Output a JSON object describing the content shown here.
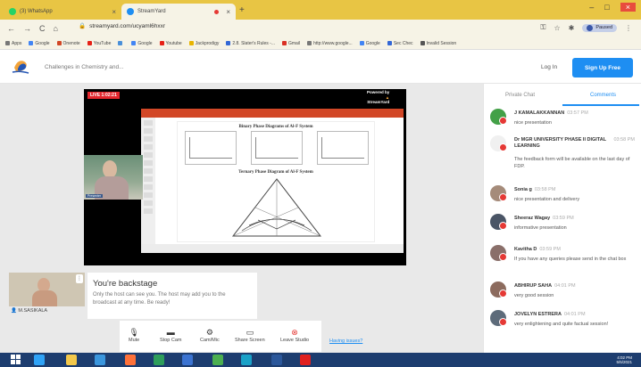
{
  "browser": {
    "tabs": [
      {
        "label": "(3) WhatsApp",
        "icon": "whatsapp-icon",
        "color": "#25d366"
      },
      {
        "label": "StreamYard",
        "icon": "streamyard-icon",
        "color": "#1e8ef2",
        "recording": true
      }
    ],
    "url": "streamyard.com/ucyaml6hxxr",
    "profile_label": "Paused",
    "profile_initial": "G",
    "bookmarks": [
      {
        "label": "Apps",
        "color": "#777"
      },
      {
        "label": "Google",
        "color": "#4285f4"
      },
      {
        "label": "Onenote",
        "color": "#d24726"
      },
      {
        "label": "YouTube",
        "color": "#e62117"
      },
      {
        "label": "",
        "color": "#4a90d9"
      },
      {
        "label": "Google",
        "color": "#4285f4"
      },
      {
        "label": "Youtube",
        "color": "#e62117"
      },
      {
        "label": "Jackprodigy",
        "color": "#e8b400"
      },
      {
        "label": "2.8. Slater's Rules -...",
        "color": "#3367d6"
      },
      {
        "label": "Gmail",
        "color": "#d93025"
      },
      {
        "label": "http://www.google...",
        "color": "#777"
      },
      {
        "label": "Google",
        "color": "#4285f4"
      },
      {
        "label": "Sec Chec",
        "color": "#3367d6"
      },
      {
        "label": "Invalid Session",
        "color": "#555"
      }
    ]
  },
  "header": {
    "show_title": "Challenges in Chemistry and...",
    "login": "Log In",
    "signup": "Sign Up Free"
  },
  "stage": {
    "live_label": "LIVE 1:02:21",
    "powered_by": "Powered by",
    "brand": "StreamYard",
    "slide_title_1": "Binary Phase Diagrams of Al-F System",
    "slide_title_2": "Ternary Phase Diagram of Al-F System",
    "presenter_tag": "Presenter"
  },
  "backstage": {
    "participant_name": "M.SASIKALA",
    "title": "You're backstage",
    "description": "Only the host can see you. The host may add you to the broadcast at any time. Be ready!"
  },
  "controls": [
    {
      "label": "Mute",
      "icon": "microphone-icon",
      "glyph": "🎙"
    },
    {
      "label": "Stop Cam",
      "icon": "camera-icon",
      "glyph": "▬"
    },
    {
      "label": "Cam/Mic",
      "icon": "gear-icon",
      "glyph": "⚙"
    },
    {
      "label": "Share Screen",
      "icon": "screen-icon",
      "glyph": "▭"
    },
    {
      "label": "Leave Studio",
      "icon": "leave-icon",
      "glyph": "⊗"
    }
  ],
  "having_issues": "Having issues?",
  "chat": {
    "tabs": [
      "Private Chat",
      "Comments"
    ],
    "active_tab": "Comments",
    "comments": [
      {
        "name": "J KAMALAKKANNAN",
        "time": "03:57 PM",
        "text": "nice presentation",
        "avatar_color": "#43a047"
      },
      {
        "name": "Dr MGR UNIVERSITY PHASE II DIGITAL LEARNING",
        "time": "03:58 PM",
        "text": "The feedback form will be available on the last day of FDP.",
        "avatar_color": "#f0f0f0"
      },
      {
        "name": "Sonia g",
        "time": "03:58 PM",
        "text": "nice presentation and delivery",
        "avatar_color": "#a58b7a"
      },
      {
        "name": "Sheeraz Wagay",
        "time": "03:59 PM",
        "text": "informative presentation",
        "avatar_color": "#4a5566"
      },
      {
        "name": "Kavitha D",
        "time": "03:59 PM",
        "text": "If you have any queries please send in the chat box",
        "avatar_color": "#8a6f6a"
      },
      {
        "name": "ABHIRUP SAHA",
        "time": "04:01 PM",
        "text": "very good session",
        "avatar_color": "#8c6b5e"
      },
      {
        "name": "JOVELYN ESTRERA",
        "time": "04:01 PM",
        "text": "very enlightening and quite factual session!",
        "avatar_color": "#5d6b7a"
      }
    ]
  },
  "taskbar": {
    "apps": [
      {
        "icon": "windows-start-icon",
        "color": "#ffffff"
      },
      {
        "icon": "photoshop-icon",
        "color": "#2fa3f7"
      },
      {
        "icon": "file-explorer-icon",
        "color": "#f3c84b"
      },
      {
        "icon": "edge-icon",
        "color": "#3a96dd"
      },
      {
        "icon": "firefox-icon",
        "color": "#ff7139"
      },
      {
        "icon": "app-green-icon",
        "color": "#2e9e5b"
      },
      {
        "icon": "app-blue-icon",
        "color": "#3b73d1"
      },
      {
        "icon": "chrome-icon",
        "color": "#4caf50"
      },
      {
        "icon": "app-teal-icon",
        "color": "#1aa1c8"
      },
      {
        "icon": "word-icon",
        "color": "#2b579a"
      },
      {
        "icon": "acrobat-icon",
        "color": "#e02020"
      }
    ],
    "time": "4:02 PM",
    "date": "5/5/2021"
  }
}
